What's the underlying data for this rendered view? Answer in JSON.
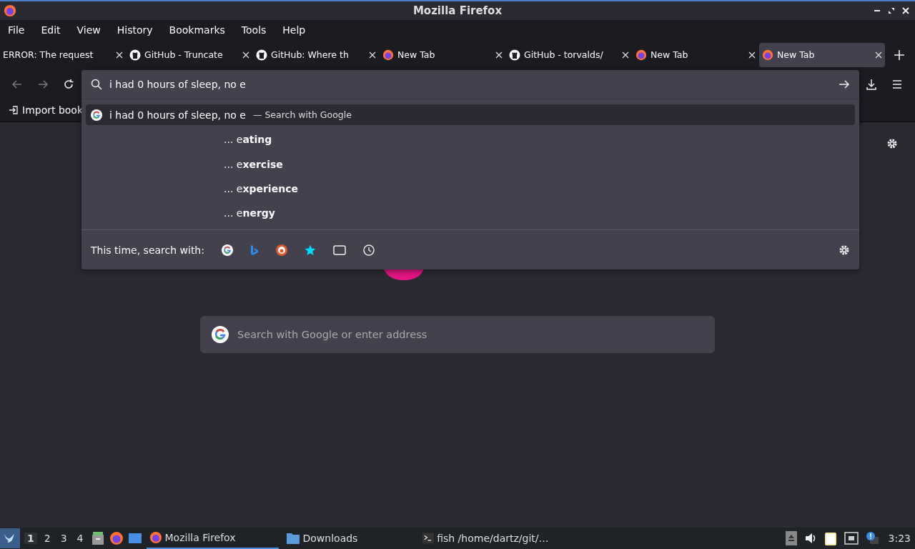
{
  "window": {
    "title": "Mozilla Firefox"
  },
  "menu": [
    "File",
    "Edit",
    "View",
    "History",
    "Bookmarks",
    "Tools",
    "Help"
  ],
  "tabs": [
    {
      "label": "ERROR: The request",
      "kind": "plain",
      "selected": false
    },
    {
      "label": "GitHub - Truncate",
      "kind": "github",
      "selected": false
    },
    {
      "label": "GitHub: Where th",
      "kind": "github",
      "selected": false
    },
    {
      "label": "New Tab",
      "kind": "firefox",
      "selected": false
    },
    {
      "label": "GitHub - torvalds/",
      "kind": "github",
      "selected": false
    },
    {
      "label": "New Tab",
      "kind": "firefox",
      "selected": false
    },
    {
      "label": "New Tab",
      "kind": "firefox",
      "selected": true
    }
  ],
  "bookmarks_bar": {
    "import": "Import book"
  },
  "urlbar": {
    "value": "i had 0 hours of sleep, no e",
    "results": [
      {
        "kind": "search",
        "text": "i had 0 hours of sleep, no e",
        "action": "— Search with Google",
        "selected": true
      },
      {
        "kind": "suggestion",
        "text": "... e**ating**",
        "selected": false
      },
      {
        "kind": "suggestion",
        "text": "... e**xercise**",
        "selected": false
      },
      {
        "kind": "suggestion",
        "text": "... e**xperience**",
        "selected": false
      },
      {
        "kind": "suggestion",
        "text": "... e**nergy**",
        "selected": false
      }
    ],
    "footer": "This time, search with:"
  },
  "page": {
    "search_placeholder": "Search with Google or enter address"
  },
  "taskbar": {
    "workspaces": [
      {
        "label": "1",
        "selected": true
      },
      {
        "label": "2",
        "selected": false
      },
      {
        "label": "3",
        "selected": false
      },
      {
        "label": "4",
        "selected": false
      }
    ],
    "tasks": [
      {
        "label": "Mozilla Firefox",
        "kind": "browser",
        "selected": true
      },
      {
        "label": "Downloads",
        "kind": "files",
        "selected": false
      },
      {
        "label": "fish /home/dartz/git/…",
        "kind": "terminal",
        "selected": false
      }
    ],
    "clock": "3:23"
  }
}
